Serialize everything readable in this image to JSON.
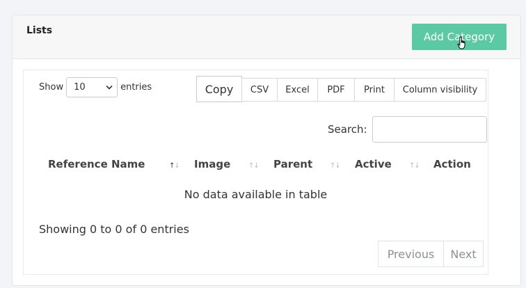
{
  "card": {
    "title": "Lists",
    "add_button_label": "Add Category"
  },
  "length_menu": {
    "show_label": "Show",
    "selected_value": "10",
    "entries_label": "entries"
  },
  "export_buttons": [
    "Copy",
    "CSV",
    "Excel",
    "PDF",
    "Print",
    "Column visibility"
  ],
  "search": {
    "label": "Search:",
    "value": ""
  },
  "table": {
    "columns": [
      "Reference Name",
      "Image",
      "Parent",
      "Active",
      "Action"
    ],
    "empty_message": "No data available in table"
  },
  "info_text": "Showing 0 to 0 of 0 entries",
  "pagination": {
    "previous_label": "Previous",
    "next_label": "Next"
  },
  "colors": {
    "accent": "#5ac9a4",
    "page_background": "#f3f4f8"
  }
}
